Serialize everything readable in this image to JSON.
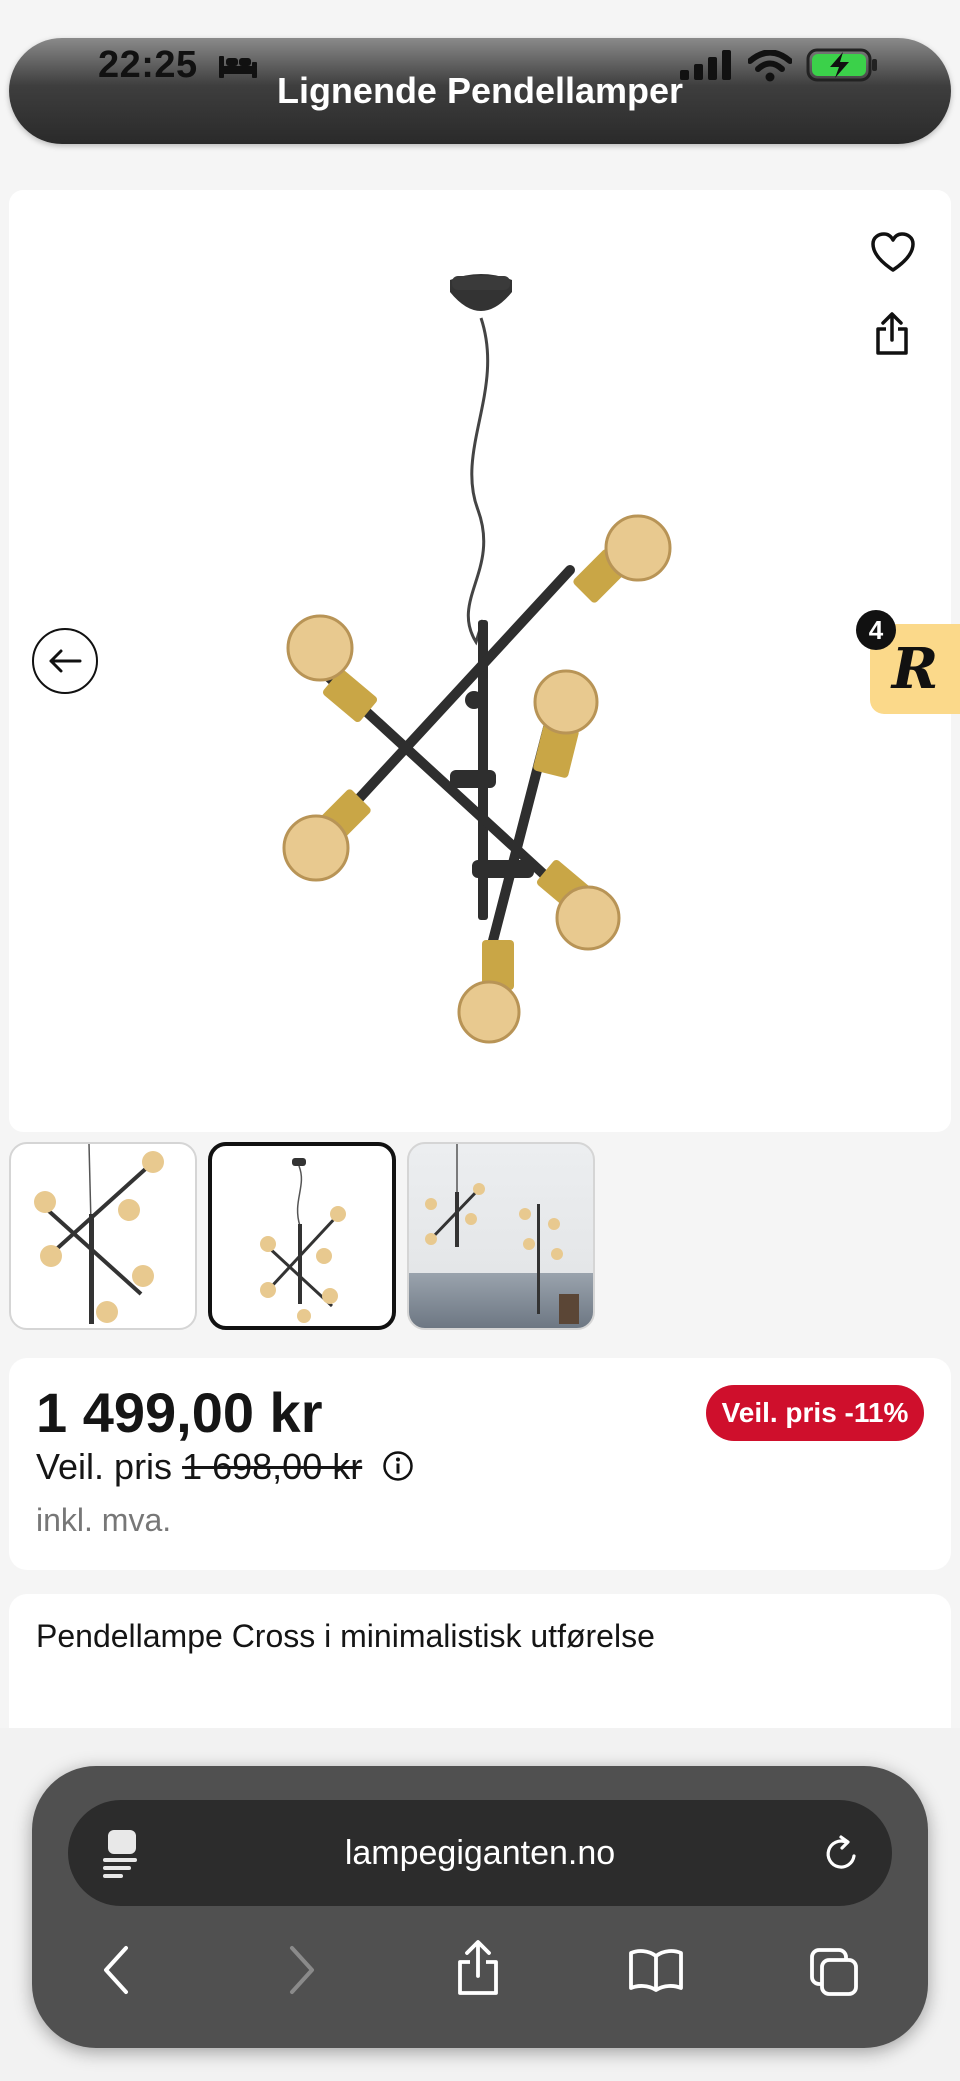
{
  "status_bar": {
    "time": "22:25"
  },
  "header": {
    "title": "Lignende Pendellamper"
  },
  "product": {
    "thumbnails": [
      {
        "label": "thumbnail-1"
      },
      {
        "label": "thumbnail-2"
      },
      {
        "label": "thumbnail-3"
      }
    ],
    "selected_thumbnail": 2
  },
  "reward": {
    "letter": "R",
    "count": "4"
  },
  "price": {
    "current": "1 499,00 kr",
    "recommended_label": "Veil. pris",
    "recommended_value": "1 698,00 kr",
    "vat_note": "inkl. mva.",
    "discount_badge": "Veil. pris -11%"
  },
  "description": {
    "title": "Pendellampe Cross i minimalistisk utførelse"
  },
  "browser": {
    "url": "lampegiganten.no"
  },
  "colors": {
    "discount": "#cf0f2c",
    "reward_badge": "#fbd98a"
  }
}
